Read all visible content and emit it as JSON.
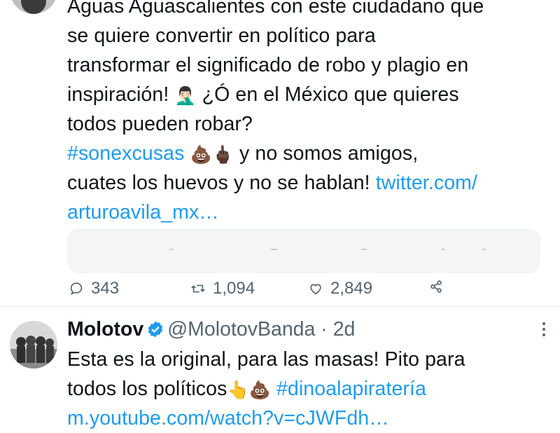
{
  "tweet1": {
    "lines": [
      "Aguas Aguascalientes con este ciudadano que",
      "se quiere convertir en político para",
      "transformar el significado  de robo y plagio en"
    ],
    "line4_text": "inspiración! ",
    "line4_emoji": "🤦🏻‍♂️",
    "line4_rest": " ¿Ó en el México que quieres",
    "line5": "todos pueden robar?",
    "hashtag": "#sonexcusas",
    "line6_emojis": " 💩🖕🏿 ",
    "line6_rest": "y no somos amigos,",
    "line7_text": "cuates los huevos y no se hablan! ",
    "link_part1": "twitter.com/",
    "link_part2": "arturoavila_mx…",
    "actions": {
      "reply_count": "343",
      "retweet_count": "1,094",
      "like_count": "2,849"
    }
  },
  "tweet2": {
    "name": "Molotov",
    "handle": "@MolotovBanda · 2d",
    "line1": "Esta es la original, para las masas! Pito para",
    "line2_text": "todos los políticos",
    "line2_emojis": "👆💩 ",
    "hashtag": "#dinoalapiratería",
    "link": "m.youtube.com/watch?v=cJWFdh…"
  },
  "colors": {
    "link": "#1d9bf0",
    "muted": "#536471",
    "card_bg": "#f3f5f7",
    "divider": "#e6ecf0"
  },
  "icons": [
    "reply-icon",
    "retweet-icon",
    "like-icon",
    "share-icon",
    "verified-badge-icon",
    "more-options-icon"
  ]
}
